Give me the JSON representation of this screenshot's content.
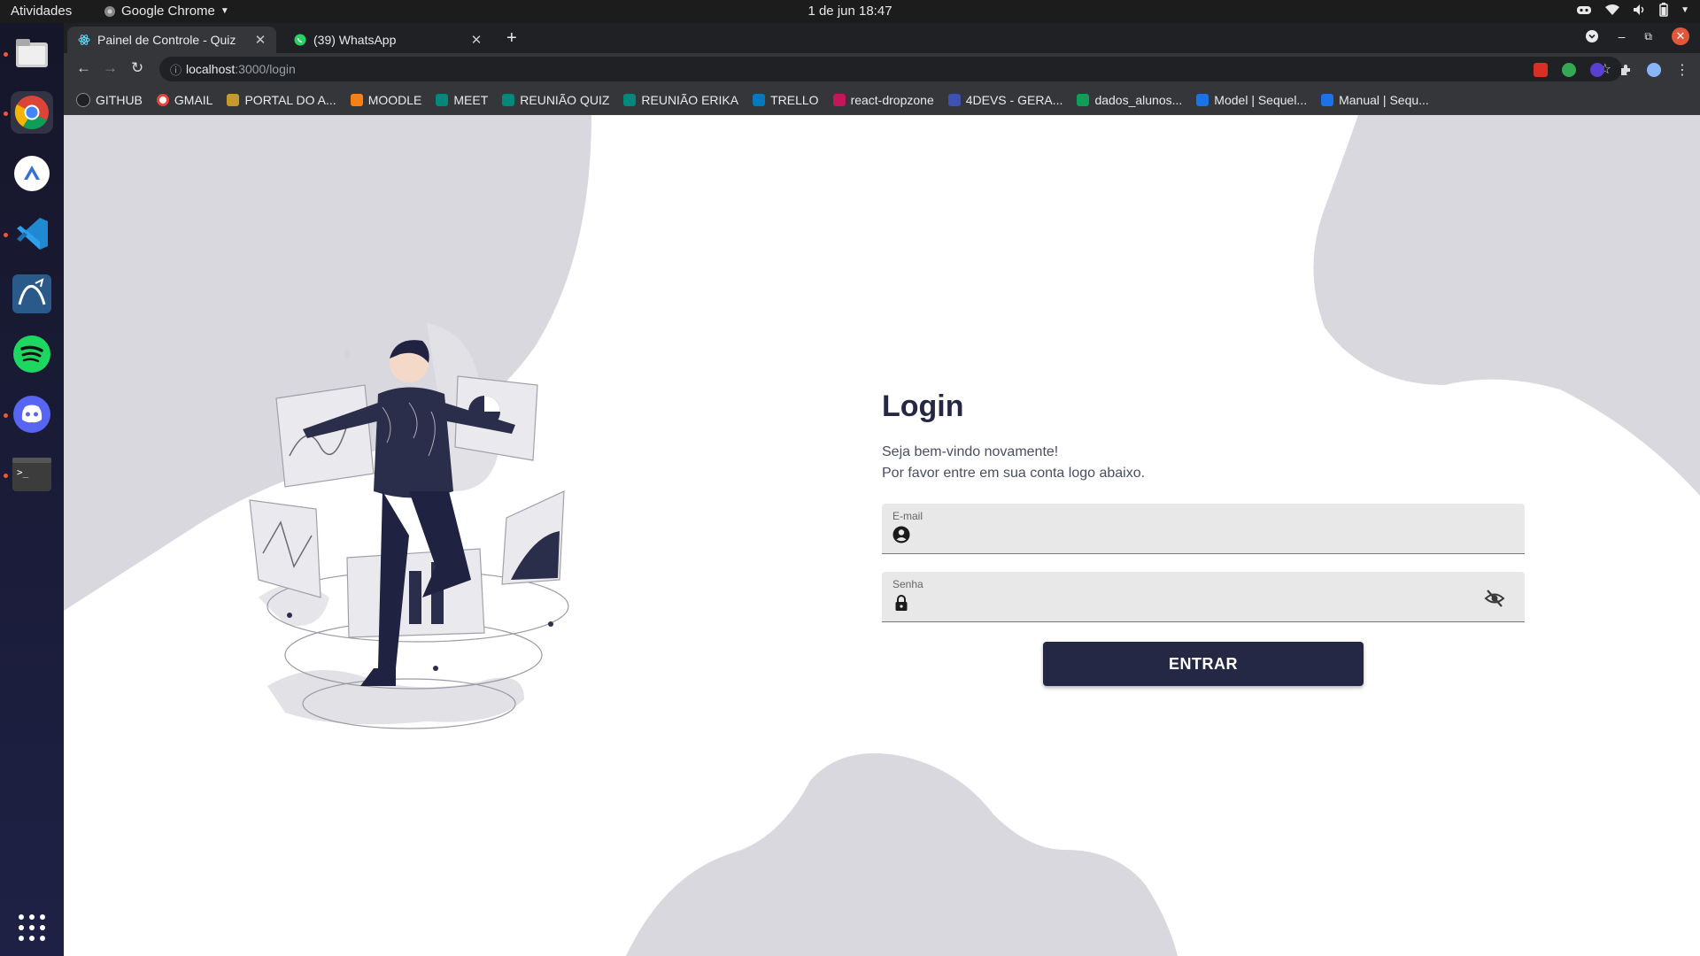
{
  "system_bar": {
    "activities": "Atividades",
    "app_name": "Google Chrome",
    "clock": "1 de jun  18:47"
  },
  "browser": {
    "tabs": [
      {
        "title": "Painel de Controle - Quiz",
        "active": true
      },
      {
        "title": "(39) WhatsApp",
        "active": false
      }
    ],
    "address": {
      "host": "localhost",
      "path": ":3000/login"
    },
    "bookmarks": [
      {
        "label": "GITHUB",
        "icon": "github-icon"
      },
      {
        "label": "GMAIL",
        "icon": "google-icon"
      },
      {
        "label": "PORTAL DO A...",
        "icon": "portal-icon"
      },
      {
        "label": "MOODLE",
        "icon": "moodle-icon"
      },
      {
        "label": "MEET",
        "icon": "meet-icon"
      },
      {
        "label": "REUNIÃO QUIZ",
        "icon": "meet-icon"
      },
      {
        "label": "REUNIÃO ERIKA",
        "icon": "meet-icon"
      },
      {
        "label": "TRELLO",
        "icon": "trello-icon"
      },
      {
        "label": "react-dropzone",
        "icon": "dropzone-icon"
      },
      {
        "label": "4DEVS - GERA...",
        "icon": "4devs-icon"
      },
      {
        "label": "dados_alunos...",
        "icon": "sheets-icon"
      },
      {
        "label": "Model | Sequel...",
        "icon": "sequelize-icon"
      },
      {
        "label": "Manual | Sequ...",
        "icon": "sequelize-icon"
      }
    ]
  },
  "dock": [
    "files-icon",
    "chrome-icon",
    "drive-icon",
    "vscode-icon",
    "mysql-workbench-icon",
    "spotify-icon",
    "discord-icon",
    "terminal-icon",
    "app-grid-icon"
  ],
  "login": {
    "title": "Login",
    "subtitle_line1": "Seja bem-vindo novamente!",
    "subtitle_line2": "Por favor entre em sua conta logo abaixo.",
    "email_label": "E-mail",
    "email_value": "",
    "password_label": "Senha",
    "password_value": "",
    "submit_label": "ENTRAR"
  },
  "colors": {
    "primary": "#252844",
    "blob": "#d9d8de"
  }
}
